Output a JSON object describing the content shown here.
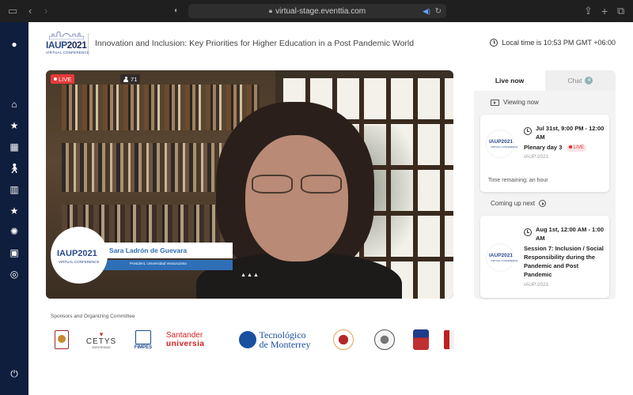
{
  "browser": {
    "url": "virtual-stage.eventtia.com",
    "icons": [
      "sidebar-toggle-icon",
      "back-icon",
      "forward-icon",
      "shield-icon",
      "lock-icon",
      "speaker-icon",
      "reload-icon",
      "share-icon",
      "new-tab-icon",
      "tabs-icon"
    ]
  },
  "sidebar": {
    "items": [
      {
        "name": "profile",
        "icon": "user-icon"
      },
      {
        "name": "home",
        "icon": "home-icon"
      },
      {
        "name": "favorites",
        "icon": "star-icon"
      },
      {
        "name": "agenda",
        "icon": "calendar-icon"
      },
      {
        "name": "speakers",
        "icon": "walking-person-icon"
      },
      {
        "name": "organizations",
        "icon": "building-icon"
      },
      {
        "name": "sponsors",
        "icon": "star-icon"
      },
      {
        "name": "gallery",
        "icon": "aperture-icon"
      },
      {
        "name": "media",
        "icon": "photo-icon"
      },
      {
        "name": "location",
        "icon": "target-icon"
      },
      {
        "name": "logout",
        "icon": "power-icon"
      }
    ],
    "background": "#0f1e3d"
  },
  "header": {
    "logo": {
      "text_iaup": "IAUP",
      "text_year": "2021",
      "subtitle": "VIRTUAL CONFERENCE"
    },
    "title": "Innovation and Inclusion: Key Priorities for Higher Education in a Post Pandemic World",
    "local_time": "Local time is 10:53 PM GMT +06:00"
  },
  "video": {
    "live_label": "LIVE",
    "viewer_count": "71",
    "speaker_name": "Dra. Sara Ladrón de Guevara",
    "speaker_role": "President, Universidad Veracruzana",
    "overlay_logo": {
      "text_iaup": "IAUP",
      "text_year": "2021",
      "subtitle": "VIRTUAL CONFERENCE"
    }
  },
  "sponsors": {
    "title": "Sponsors and Organizing Committee",
    "items": [
      {
        "name": "amurex",
        "label": "AMUREX"
      },
      {
        "name": "cetys",
        "label": "CETYS",
        "sub": "UNIVERSIDAD"
      },
      {
        "name": "fimpes",
        "label": "FIMPES"
      },
      {
        "name": "santander",
        "label": "Santander",
        "sub": "universia"
      },
      {
        "name": "tec",
        "label": "Tecnológico",
        "sub": "de Monterrey"
      },
      {
        "name": "seal-1"
      },
      {
        "name": "seal-2"
      },
      {
        "name": "seal-3"
      },
      {
        "name": "seal-4"
      }
    ]
  },
  "panel": {
    "tabs": {
      "live": "Live now",
      "chat": "Chat",
      "chat_count": "4"
    },
    "viewing_now": "Viewing now",
    "coming_up_next": "Coming up next",
    "current": {
      "time": "Jul 31st, 9:00 PM - 12:00 AM",
      "title": "Plenary day 3",
      "live": "LIVE",
      "org": "IAUP 2021",
      "remaining": "Time remaining: an hour",
      "logo": {
        "text": "IAUP2021",
        "subtitle": "VIRTUAL CONFERENCE"
      }
    },
    "next": {
      "time": "Aug 1st, 12:00 AM - 1:00 AM",
      "title": "Session 7: Inclusion / Social Responsibility during the Pandemic and Post Pandemic",
      "org": "IAUP 2021",
      "logo": {
        "text": "IAUP2021",
        "subtitle": "VIRTUAL CONFERENCE"
      }
    }
  }
}
